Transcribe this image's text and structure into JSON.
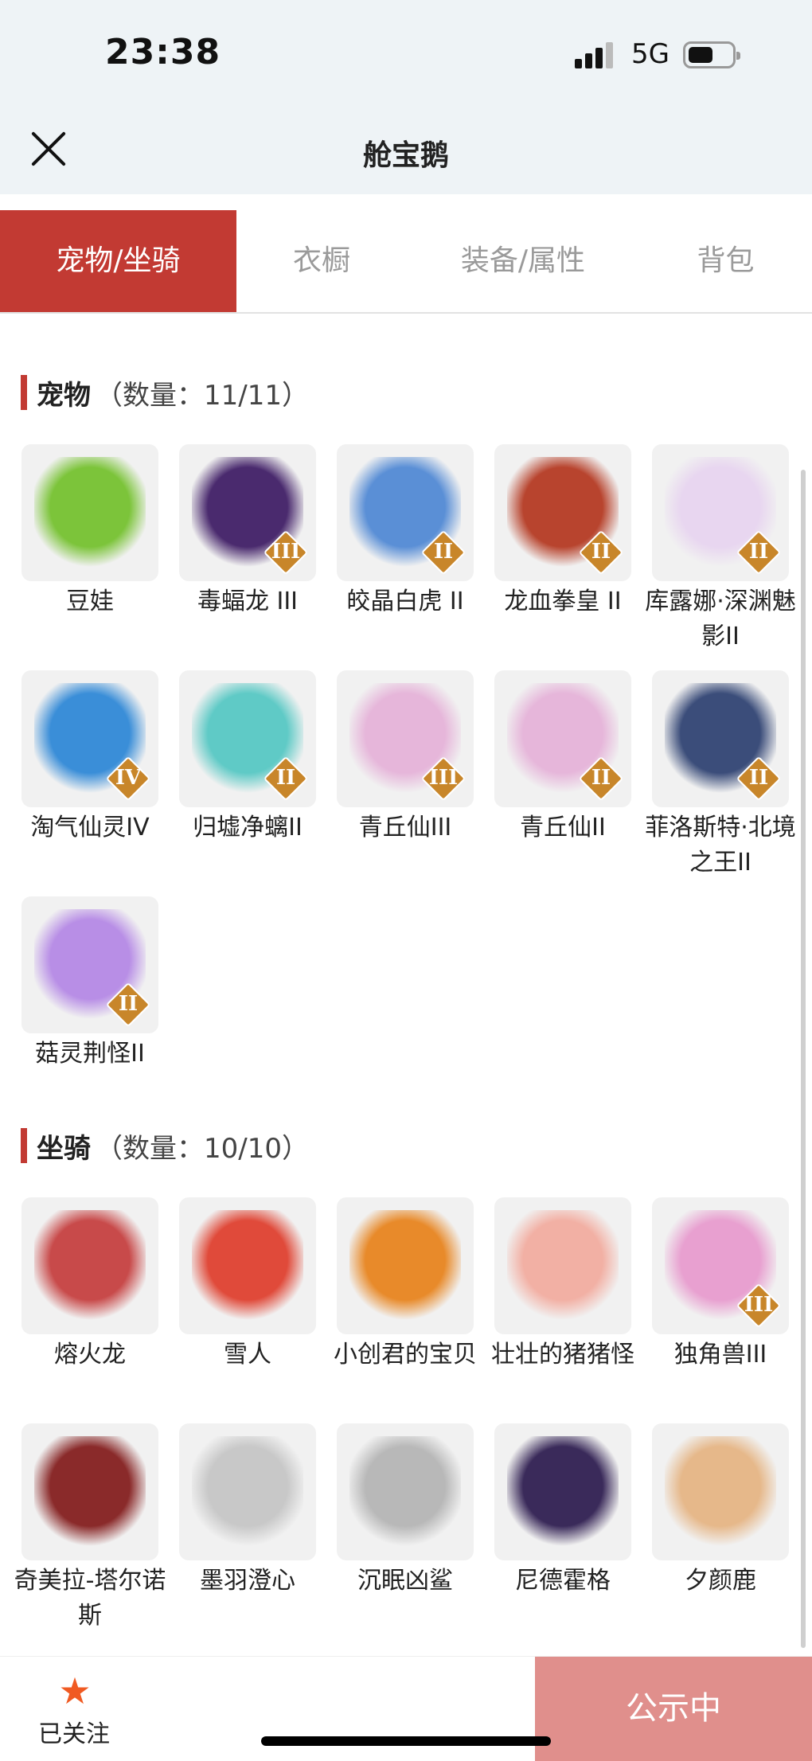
{
  "status_bar": {
    "time": "23:38",
    "network": "5G"
  },
  "nav": {
    "title": "舱宝鹅"
  },
  "tabs": [
    {
      "label": "宠物/坐骑",
      "active": true
    },
    {
      "label": "衣橱",
      "active": false
    },
    {
      "label": "装备/属性",
      "active": false
    },
    {
      "label": "背包",
      "active": false
    }
  ],
  "pets": {
    "title": "宠物",
    "count": "（数量：11/11）",
    "items": [
      {
        "name": "豆娃",
        "badge": "",
        "icon": "green-bean-creature-icon",
        "color": "#7cc43a"
      },
      {
        "name": "毒蝠龙 III",
        "badge": "III",
        "icon": "purple-bat-dragon-icon",
        "color": "#4a2a6e"
      },
      {
        "name": "皎晶白虎 II",
        "badge": "II",
        "icon": "white-tiger-icon",
        "color": "#5a8fd6"
      },
      {
        "name": "龙血拳皇 II",
        "badge": "II",
        "icon": "red-demon-icon",
        "color": "#b8442e"
      },
      {
        "name": "库露娜·深渊魅影II",
        "badge": "II",
        "icon": "white-spirit-girl-icon",
        "color": "#e8d6f0"
      },
      {
        "name": "淘气仙灵IV",
        "badge": "IV",
        "icon": "blue-puppy-icon",
        "color": "#3a8ed8"
      },
      {
        "name": "归墟净螭II",
        "badge": "II",
        "icon": "cyan-dragon-icon",
        "color": "#5fcac6"
      },
      {
        "name": "青丘仙III",
        "badge": "III",
        "icon": "fox-fairy-icon",
        "color": "#e6b6da"
      },
      {
        "name": "青丘仙II",
        "badge": "II",
        "icon": "fox-fairy-icon",
        "color": "#e6b6da"
      },
      {
        "name": "菲洛斯特·北境之王II",
        "badge": "II",
        "icon": "ice-king-icon",
        "color": "#3b4d7a"
      },
      {
        "name": "菇灵荆怪II",
        "badge": "II",
        "icon": "purple-mushroom-elf-icon",
        "color": "#b88ee6"
      }
    ]
  },
  "mounts": {
    "title": "坐骑",
    "count": "（数量：10/10）",
    "items": [
      {
        "name": "熔火龙",
        "badge": "",
        "icon": "red-dragon-head-icon",
        "color": "#c84a4a"
      },
      {
        "name": "雪人",
        "badge": "",
        "icon": "snowman-icon",
        "color": "#e04a3a"
      },
      {
        "name": "小创君的宝贝",
        "badge": "",
        "icon": "phoenix-bird-icon",
        "color": "#e88a2a"
      },
      {
        "name": "壮壮的猪猪怪",
        "badge": "",
        "icon": "pig-icon",
        "color": "#f2b0a4"
      },
      {
        "name": "独角兽III",
        "badge": "III",
        "icon": "unicorn-icon",
        "color": "#e8a0d0"
      },
      {
        "name": "奇美拉-塔尔诺斯",
        "badge": "",
        "icon": "chimera-icon",
        "color": "#8a2a2a"
      },
      {
        "name": "墨羽澄心",
        "badge": "",
        "icon": "winged-staff-icon",
        "color": "#c8c8c8"
      },
      {
        "name": "沉眠凶鲨",
        "badge": "",
        "icon": "shark-icon",
        "color": "#b8b8b8"
      },
      {
        "name": "尼德霍格",
        "badge": "",
        "icon": "dark-dragon-icon",
        "color": "#3a2a5a"
      },
      {
        "name": "夕颜鹿",
        "badge": "",
        "icon": "deer-icon",
        "color": "#e6b88a"
      }
    ]
  },
  "bottom": {
    "follow_label": "已关注",
    "public_label": "公示中"
  },
  "colors": {
    "accent": "#c23a33",
    "badge": "#c8862a",
    "star": "#f05a22",
    "public_button": "#e08f8c"
  }
}
